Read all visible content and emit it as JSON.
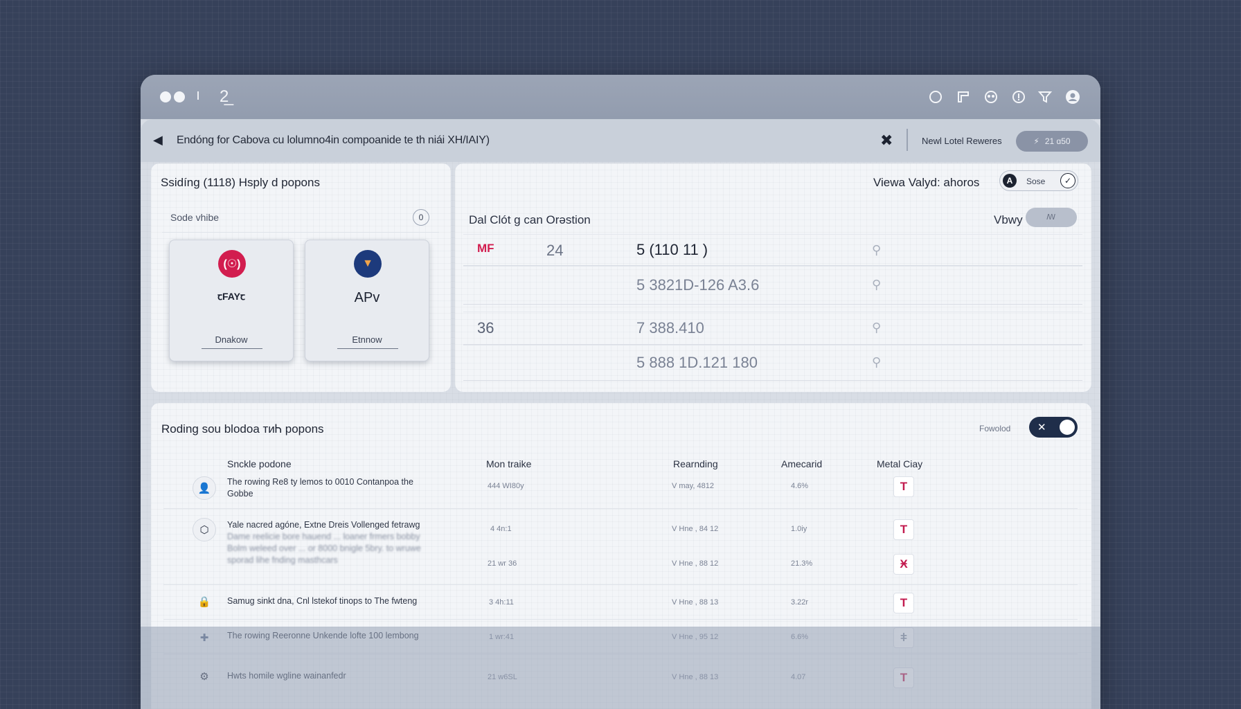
{
  "titlebar": {
    "glyph": "2̲",
    "icons": [
      "circle-icon",
      "flag-icon",
      "user-group-icon",
      "info-icon",
      "filter-icon",
      "account-icon"
    ]
  },
  "breadcrumb": {
    "text": "Endóng for Cabova cu lolumno4in compoanide te th niái XH/IAIY)",
    "rewards_label": "Newl Lotel Reweres",
    "rewards_value": "21 ɑ50"
  },
  "left_panel": {
    "title": "Ssidíng (1118) Hsply d popons",
    "search_label": "Sode vhibe",
    "search_btn": "0",
    "cards": [
      {
        "logo": "(☉)",
        "name": "ꞇFAYꞇ",
        "action": "Dnakow",
        "color": "#d21d4f"
      },
      {
        "logo": "▼",
        "name": "APv",
        "action": "Etnnow",
        "color": "#1d3a7c"
      }
    ]
  },
  "right_panel": {
    "views_label": "Viewa Valyd: ahoros",
    "views_toggle_badge": "A",
    "views_toggle_label": "Sose",
    "subtitle": "Dal Clót g can Orǝstion",
    "view_label": "Vbwy",
    "view_toggle_label": "ꟿ",
    "rows": [
      {
        "c1": "MF",
        "c2": "24",
        "c3": "5 (110 11 )",
        "icon": "⚲"
      },
      {
        "c1": "",
        "c2": "",
        "c3": "5 3821D-126 A3.6",
        "icon": "⚲"
      },
      {
        "c1": "36",
        "c2": "",
        "c3": "7 388.410",
        "icon": "⚲"
      },
      {
        "c1": "",
        "c2": "",
        "c3": "5 888 1D.121 180",
        "icon": "⚲"
      }
    ]
  },
  "bottom_panel": {
    "title": "Roding sou blodoa ᴛᴎᏂ popons",
    "filtered_label": "Fowolod",
    "headers": [
      "Snckle podone",
      "Mon traike",
      "Rearnding",
      "Amecarid",
      "Metal Ciay"
    ],
    "rows": [
      {
        "icon": "👤",
        "text": "The rowing Re8 ty lemos to 0010 Contanpoa the",
        "text2": "Gobbe",
        "c1": "444 WI80y",
        "c2": "V may, 4812",
        "c3": "4.6%",
        "flag": "T"
      },
      {
        "icon": "⬡",
        "text": "Yale nacred agóne, Extne Dreis Vollenged fetrawg",
        "text2": "Dame reelicie bore hauend ... loaner frmers bobby",
        "c1": "4 4n:1",
        "c2": "V Hne , 84 12",
        "c3": "1.0iy",
        "flag": "T"
      },
      {
        "icon": "",
        "text": "Bolm weleed over ... or 8000 bnigle 5bry. to wruwe",
        "text2": "sporad lihe fnding masthcars",
        "c1": "21 wr 36",
        "c2": "V Hne , 88 12",
        "c3": "21.3%",
        "flag": "Ӿ"
      },
      {
        "icon": "🔒",
        "text": "Samug sinkt dna, Cnl lstekof tinops to The fwteng",
        "text2": "",
        "c1": "3 4h:11",
        "c2": "V Hne , 88 13",
        "c3": "3.22r",
        "flag": "T"
      },
      {
        "icon": "✚",
        "text": "The rowing Reeronne Unkende lofte 100 lembong",
        "text2": "",
        "c1": "1 wr:41",
        "c2": "V Hne , 95 12",
        "c3": "6.6%",
        "flag": "ǂ"
      },
      {
        "icon": "⚙",
        "text": "Hwts homile wgline wainanfedr",
        "text2": "",
        "c1": "21 w6SL",
        "c2": "V Hne , 88 13",
        "c3": "4.07",
        "flag": "T"
      }
    ]
  }
}
